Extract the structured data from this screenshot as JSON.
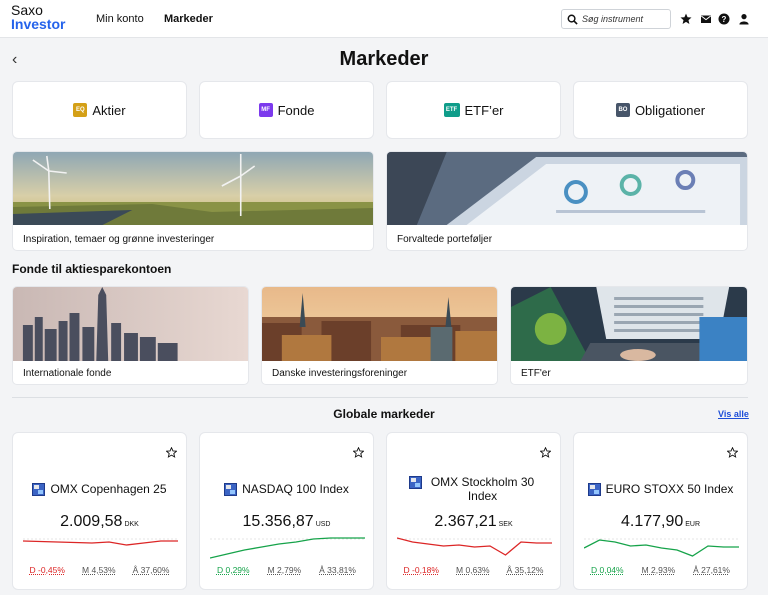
{
  "app": {
    "logo_line1": "Saxo",
    "logo_line2": "Investor",
    "nav": [
      "Min konto",
      "Markeder"
    ],
    "search_placeholder": "Søg instrument"
  },
  "page": {
    "title": "Markeder",
    "back_symbol": "‹"
  },
  "categories": [
    {
      "badge": "EQ",
      "label": "Aktier",
      "color": "#d4a017"
    },
    {
      "badge": "MF",
      "label": "Fonde",
      "color": "#7c3aed"
    },
    {
      "badge": "ETF",
      "label": "ETF’er",
      "color": "#0f9d8a"
    },
    {
      "badge": "BO",
      "label": "Obligationer",
      "color": "#475569"
    }
  ],
  "features": [
    {
      "caption": "Inspiration, temaer og grønne investeringer"
    },
    {
      "caption": "Forvaltede porteføljer"
    }
  ],
  "funds_section": {
    "title": "Fonde til aktiesparekontoen",
    "items": [
      {
        "caption": "Internationale fonde"
      },
      {
        "caption": "Danske investeringsforeninger"
      },
      {
        "caption": "ETF'er"
      }
    ]
  },
  "markets": {
    "title": "Globale markeder",
    "view_all": "Vis alle",
    "items": [
      {
        "name": "OMX Copenhagen 25",
        "price": "2.009,58",
        "currency": "DKK",
        "d": "D -0,45%",
        "m": "M 4,53%",
        "y": "Å 37,60%",
        "trend": "neg",
        "spark": [
          5,
          5.5,
          6,
          6.5,
          7,
          6,
          9,
          7,
          5,
          5
        ]
      },
      {
        "name": "NASDAQ 100 Index",
        "price": "15.356,87",
        "currency": "USD",
        "d": "D 0,29%",
        "m": "M 2,79%",
        "y": "Å 33,81%",
        "trend": "pos",
        "spark": [
          22,
          18,
          14,
          11,
          8,
          6,
          3,
          2,
          2,
          2
        ]
      },
      {
        "name": "OMX Stockholm 30 Index",
        "price": "2.367,21",
        "currency": "SEK",
        "d": "D -0,18%",
        "m": "M 0,63%",
        "y": "Å 35,12%",
        "trend": "neg",
        "spark": [
          2,
          6,
          8,
          10,
          9,
          11,
          10,
          19,
          6,
          7,
          7
        ]
      },
      {
        "name": "EURO STOXX 50 Index",
        "price": "4.177,90",
        "currency": "EUR",
        "d": "D 0,04%",
        "m": "M 2,93%",
        "y": "Å 27,61%",
        "trend": "pos",
        "spark": [
          12,
          4,
          6,
          10,
          9,
          12,
          14,
          20,
          10,
          11,
          11
        ]
      }
    ]
  },
  "colors": {
    "accent": "#2563eb",
    "negative": "#dc2626",
    "positive": "#16a34a"
  },
  "icons": [
    "search-icon",
    "star-icon",
    "mail-icon",
    "help-icon",
    "user-icon",
    "back-icon"
  ]
}
